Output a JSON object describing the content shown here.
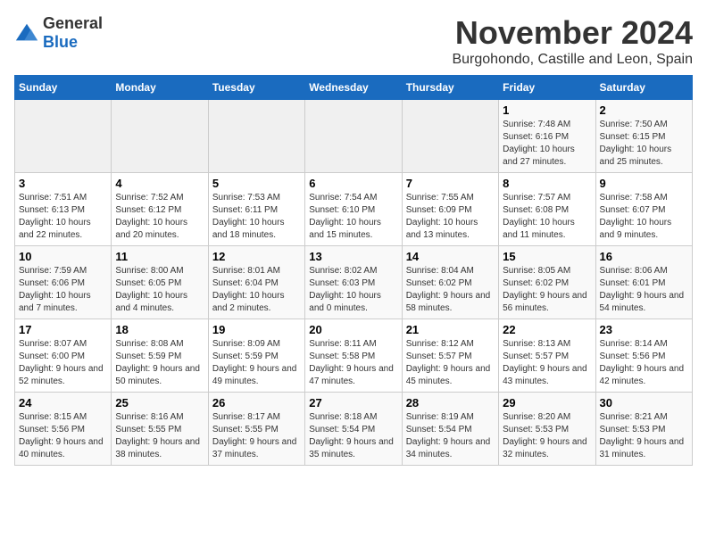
{
  "logo": {
    "general": "General",
    "blue": "Blue"
  },
  "title": "November 2024",
  "location": "Burgohondo, Castille and Leon, Spain",
  "weekdays": [
    "Sunday",
    "Monday",
    "Tuesday",
    "Wednesday",
    "Thursday",
    "Friday",
    "Saturday"
  ],
  "weeks": [
    [
      {
        "day": "",
        "sunrise": "",
        "sunset": "",
        "daylight": ""
      },
      {
        "day": "",
        "sunrise": "",
        "sunset": "",
        "daylight": ""
      },
      {
        "day": "",
        "sunrise": "",
        "sunset": "",
        "daylight": ""
      },
      {
        "day": "",
        "sunrise": "",
        "sunset": "",
        "daylight": ""
      },
      {
        "day": "",
        "sunrise": "",
        "sunset": "",
        "daylight": ""
      },
      {
        "day": "1",
        "sunrise": "Sunrise: 7:48 AM",
        "sunset": "Sunset: 6:16 PM",
        "daylight": "Daylight: 10 hours and 27 minutes."
      },
      {
        "day": "2",
        "sunrise": "Sunrise: 7:50 AM",
        "sunset": "Sunset: 6:15 PM",
        "daylight": "Daylight: 10 hours and 25 minutes."
      }
    ],
    [
      {
        "day": "3",
        "sunrise": "Sunrise: 7:51 AM",
        "sunset": "Sunset: 6:13 PM",
        "daylight": "Daylight: 10 hours and 22 minutes."
      },
      {
        "day": "4",
        "sunrise": "Sunrise: 7:52 AM",
        "sunset": "Sunset: 6:12 PM",
        "daylight": "Daylight: 10 hours and 20 minutes."
      },
      {
        "day": "5",
        "sunrise": "Sunrise: 7:53 AM",
        "sunset": "Sunset: 6:11 PM",
        "daylight": "Daylight: 10 hours and 18 minutes."
      },
      {
        "day": "6",
        "sunrise": "Sunrise: 7:54 AM",
        "sunset": "Sunset: 6:10 PM",
        "daylight": "Daylight: 10 hours and 15 minutes."
      },
      {
        "day": "7",
        "sunrise": "Sunrise: 7:55 AM",
        "sunset": "Sunset: 6:09 PM",
        "daylight": "Daylight: 10 hours and 13 minutes."
      },
      {
        "day": "8",
        "sunrise": "Sunrise: 7:57 AM",
        "sunset": "Sunset: 6:08 PM",
        "daylight": "Daylight: 10 hours and 11 minutes."
      },
      {
        "day": "9",
        "sunrise": "Sunrise: 7:58 AM",
        "sunset": "Sunset: 6:07 PM",
        "daylight": "Daylight: 10 hours and 9 minutes."
      }
    ],
    [
      {
        "day": "10",
        "sunrise": "Sunrise: 7:59 AM",
        "sunset": "Sunset: 6:06 PM",
        "daylight": "Daylight: 10 hours and 7 minutes."
      },
      {
        "day": "11",
        "sunrise": "Sunrise: 8:00 AM",
        "sunset": "Sunset: 6:05 PM",
        "daylight": "Daylight: 10 hours and 4 minutes."
      },
      {
        "day": "12",
        "sunrise": "Sunrise: 8:01 AM",
        "sunset": "Sunset: 6:04 PM",
        "daylight": "Daylight: 10 hours and 2 minutes."
      },
      {
        "day": "13",
        "sunrise": "Sunrise: 8:02 AM",
        "sunset": "Sunset: 6:03 PM",
        "daylight": "Daylight: 10 hours and 0 minutes."
      },
      {
        "day": "14",
        "sunrise": "Sunrise: 8:04 AM",
        "sunset": "Sunset: 6:02 PM",
        "daylight": "Daylight: 9 hours and 58 minutes."
      },
      {
        "day": "15",
        "sunrise": "Sunrise: 8:05 AM",
        "sunset": "Sunset: 6:02 PM",
        "daylight": "Daylight: 9 hours and 56 minutes."
      },
      {
        "day": "16",
        "sunrise": "Sunrise: 8:06 AM",
        "sunset": "Sunset: 6:01 PM",
        "daylight": "Daylight: 9 hours and 54 minutes."
      }
    ],
    [
      {
        "day": "17",
        "sunrise": "Sunrise: 8:07 AM",
        "sunset": "Sunset: 6:00 PM",
        "daylight": "Daylight: 9 hours and 52 minutes."
      },
      {
        "day": "18",
        "sunrise": "Sunrise: 8:08 AM",
        "sunset": "Sunset: 5:59 PM",
        "daylight": "Daylight: 9 hours and 50 minutes."
      },
      {
        "day": "19",
        "sunrise": "Sunrise: 8:09 AM",
        "sunset": "Sunset: 5:59 PM",
        "daylight": "Daylight: 9 hours and 49 minutes."
      },
      {
        "day": "20",
        "sunrise": "Sunrise: 8:11 AM",
        "sunset": "Sunset: 5:58 PM",
        "daylight": "Daylight: 9 hours and 47 minutes."
      },
      {
        "day": "21",
        "sunrise": "Sunrise: 8:12 AM",
        "sunset": "Sunset: 5:57 PM",
        "daylight": "Daylight: 9 hours and 45 minutes."
      },
      {
        "day": "22",
        "sunrise": "Sunrise: 8:13 AM",
        "sunset": "Sunset: 5:57 PM",
        "daylight": "Daylight: 9 hours and 43 minutes."
      },
      {
        "day": "23",
        "sunrise": "Sunrise: 8:14 AM",
        "sunset": "Sunset: 5:56 PM",
        "daylight": "Daylight: 9 hours and 42 minutes."
      }
    ],
    [
      {
        "day": "24",
        "sunrise": "Sunrise: 8:15 AM",
        "sunset": "Sunset: 5:56 PM",
        "daylight": "Daylight: 9 hours and 40 minutes."
      },
      {
        "day": "25",
        "sunrise": "Sunrise: 8:16 AM",
        "sunset": "Sunset: 5:55 PM",
        "daylight": "Daylight: 9 hours and 38 minutes."
      },
      {
        "day": "26",
        "sunrise": "Sunrise: 8:17 AM",
        "sunset": "Sunset: 5:55 PM",
        "daylight": "Daylight: 9 hours and 37 minutes."
      },
      {
        "day": "27",
        "sunrise": "Sunrise: 8:18 AM",
        "sunset": "Sunset: 5:54 PM",
        "daylight": "Daylight: 9 hours and 35 minutes."
      },
      {
        "day": "28",
        "sunrise": "Sunrise: 8:19 AM",
        "sunset": "Sunset: 5:54 PM",
        "daylight": "Daylight: 9 hours and 34 minutes."
      },
      {
        "day": "29",
        "sunrise": "Sunrise: 8:20 AM",
        "sunset": "Sunset: 5:53 PM",
        "daylight": "Daylight: 9 hours and 32 minutes."
      },
      {
        "day": "30",
        "sunrise": "Sunrise: 8:21 AM",
        "sunset": "Sunset: 5:53 PM",
        "daylight": "Daylight: 9 hours and 31 minutes."
      }
    ]
  ]
}
